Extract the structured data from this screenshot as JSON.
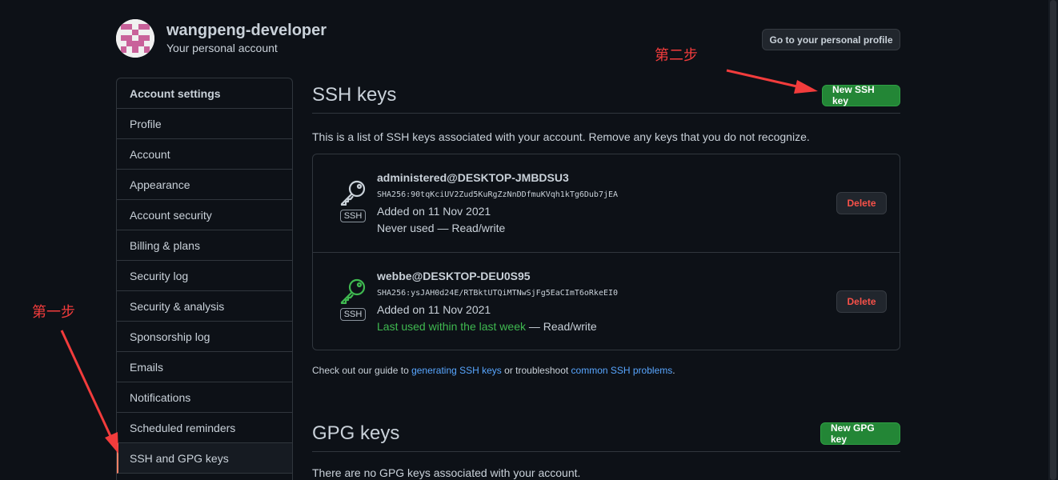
{
  "user": {
    "name": "wangpeng-developer",
    "subtitle": "Your personal account",
    "profile_button": "Go to your personal profile"
  },
  "sidebar": {
    "items": [
      {
        "label": "Account settings"
      },
      {
        "label": "Profile"
      },
      {
        "label": "Account"
      },
      {
        "label": "Appearance"
      },
      {
        "label": "Account security"
      },
      {
        "label": "Billing & plans"
      },
      {
        "label": "Security log"
      },
      {
        "label": "Security & analysis"
      },
      {
        "label": "Sponsorship log"
      },
      {
        "label": "Emails"
      },
      {
        "label": "Notifications"
      },
      {
        "label": "Scheduled reminders"
      },
      {
        "label": "SSH and GPG keys"
      }
    ],
    "selected": "SSH and GPG keys"
  },
  "ssh": {
    "title": "SSH keys",
    "new_button": "New SSH key",
    "intro": "This is a list of SSH keys associated with your account. Remove any keys that you do not recognize.",
    "badge": "SSH",
    "delete_label": "Delete",
    "keys": [
      {
        "title": "administered@DESKTOP-JMBDSU3",
        "fingerprint": "SHA256:90tqKciUV2Zud5KuRgZzNnDDfmuKVqh1kTg6Dub7jEA",
        "added": "Added on 11 Nov 2021",
        "used": "Never used",
        "access": " — Read/write",
        "icon_color": "#c9d1d9"
      },
      {
        "title": "webbe@DESKTOP-DEU0S95",
        "fingerprint": "SHA256:ysJAH0d24E/RTBktUTQiMTNwSjFg5EaCImT6oRkeEI0",
        "added": "Added on 11 Nov 2021",
        "used": "Last used within the last week",
        "access": " — Read/write",
        "icon_color": "#3fb950"
      }
    ],
    "guide": {
      "prefix": "Check out our guide to ",
      "link1": "generating SSH keys",
      "middle": " or troubleshoot ",
      "link2": "common SSH problems",
      "suffix": "."
    }
  },
  "gpg": {
    "title": "GPG keys",
    "new_button": "New GPG key",
    "empty": "There are no GPG keys associated with your account."
  },
  "annotations": {
    "step1": "第一步",
    "step2": "第二步",
    "color": "#f23c3c"
  },
  "colors": {
    "background": "#0d1117",
    "border": "#30363d",
    "green": "#238636",
    "link": "#58a6ff",
    "danger": "#f85149"
  }
}
